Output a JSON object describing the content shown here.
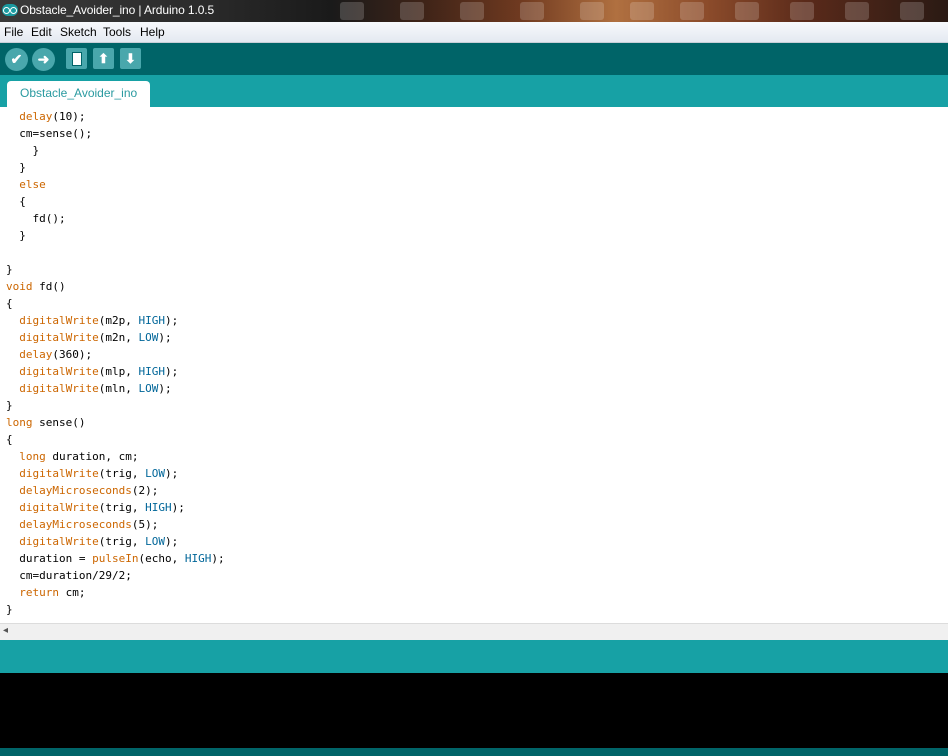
{
  "window": {
    "title": "Obstacle_Avoider_ino | Arduino 1.0.5"
  },
  "menu": {
    "items": [
      "File",
      "Edit",
      "Sketch",
      "Tools",
      "Help"
    ]
  },
  "toolbar": {
    "buttons": [
      {
        "name": "verify",
        "icon": "checkmark-icon",
        "glyph": "✔"
      },
      {
        "name": "upload",
        "icon": "arrow-right-icon",
        "glyph": "➜"
      },
      {
        "name": "new",
        "icon": "new-document-icon",
        "glyph": ""
      },
      {
        "name": "open",
        "icon": "arrow-up-icon",
        "glyph": "⬆"
      },
      {
        "name": "save",
        "icon": "arrow-down-icon",
        "glyph": "⬇"
      }
    ]
  },
  "tabs": [
    {
      "label": "Obstacle_Avoider_ino",
      "active": true
    }
  ],
  "editor": {
    "lines": [
      "  delay(10);",
      "  cm=sense();",
      "    }",
      "  }",
      "  else",
      "  {",
      "    fd();",
      "  }",
      "",
      "}",
      "void fd()",
      "{",
      "  digitalWrite(m2p, HIGH);",
      "  digitalWrite(m2n, LOW);",
      "  delay(360);",
      "  digitalWrite(mlp, HIGH);",
      "  digitalWrite(mln, LOW);",
      "}",
      "long sense()",
      "{",
      "  long duration, cm;",
      "  digitalWrite(trig, LOW);",
      "  delayMicroseconds(2);",
      "  digitalWrite(trig, HIGH);",
      "  delayMicroseconds(5);",
      "  digitalWrite(trig, LOW);",
      "  duration = pulseIn(echo, HIGH);",
      "  cm=duration/29/2;",
      "  return cm;",
      "}"
    ],
    "keywords": [
      "else",
      "void",
      "long",
      "return"
    ],
    "functions": [
      "delay",
      "digitalWrite",
      "delayMicroseconds",
      "pulseIn"
    ],
    "constants": [
      "HIGH",
      "LOW"
    ]
  },
  "colors": {
    "toolbar_bg": "#006468",
    "tabbar_bg": "#17a1a5",
    "keyword": "#cc6600",
    "constant": "#006699"
  },
  "scrollbar": {
    "left_arrow": "◂"
  },
  "status": {
    "text": ""
  },
  "console": {
    "text": ""
  }
}
